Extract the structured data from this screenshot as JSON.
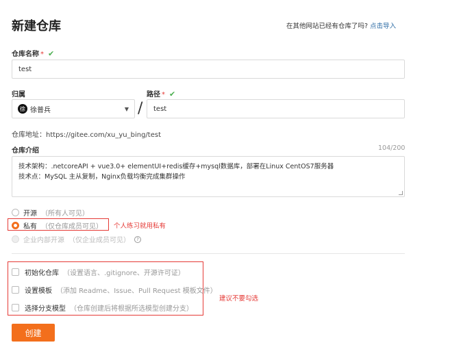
{
  "header": {
    "title": "新建仓库",
    "import_prompt": "在其他网站已经有仓库了吗?",
    "import_link": "点击导入"
  },
  "repo_name": {
    "label": "仓库名称",
    "required_mark": "*",
    "valid_mark": "✔",
    "value": "test"
  },
  "owner": {
    "label": "归属",
    "avatar_text": "徐",
    "name": "徐普兵",
    "caret": "▼"
  },
  "path": {
    "label": "路径",
    "required_mark": "*",
    "valid_mark": "✔",
    "separator": "/",
    "value": "test"
  },
  "repo_address": "仓库地址：https://gitee.com/xu_yu_bing/test",
  "description": {
    "label": "仓库介绍",
    "counter": "104/200",
    "line1": "技术架构：.netcoreAPI + vue3.0+ elementUI+redis缓存+mysql数据库，部署在Linux CentOS7服务器",
    "line2": "技术点：MySQL 主从复制，Nginx负载均衡完成集群操作"
  },
  "visibility": {
    "options": [
      {
        "label": "开源",
        "hint": "（所有人可见）",
        "state": "unselected"
      },
      {
        "label": "私有",
        "hint": "（仅仓库成员可见）",
        "state": "selected"
      },
      {
        "label": "企业内部开源",
        "hint": "（仅企业成员可见）",
        "state": "disabled"
      }
    ],
    "annotation": "个人练习就用私有",
    "help_icon": "?"
  },
  "init_options": {
    "items": [
      {
        "label": "初始化仓库",
        "hint": "（设置语言、.gitignore、开源许可证）"
      },
      {
        "label": "设置模板",
        "hint": "（添加 Readme、Issue、Pull Request 模板文件）"
      },
      {
        "label": "选择分支模型",
        "hint": "（仓库创建后将根据所选模型创建分支）"
      }
    ],
    "annotation": "建议不要勾选"
  },
  "actions": {
    "create_label": "创建"
  },
  "colors": {
    "accent": "#f36f1c",
    "link": "#2f6da6",
    "annotation_red": "#e53935",
    "valid_green": "#4caf50"
  }
}
